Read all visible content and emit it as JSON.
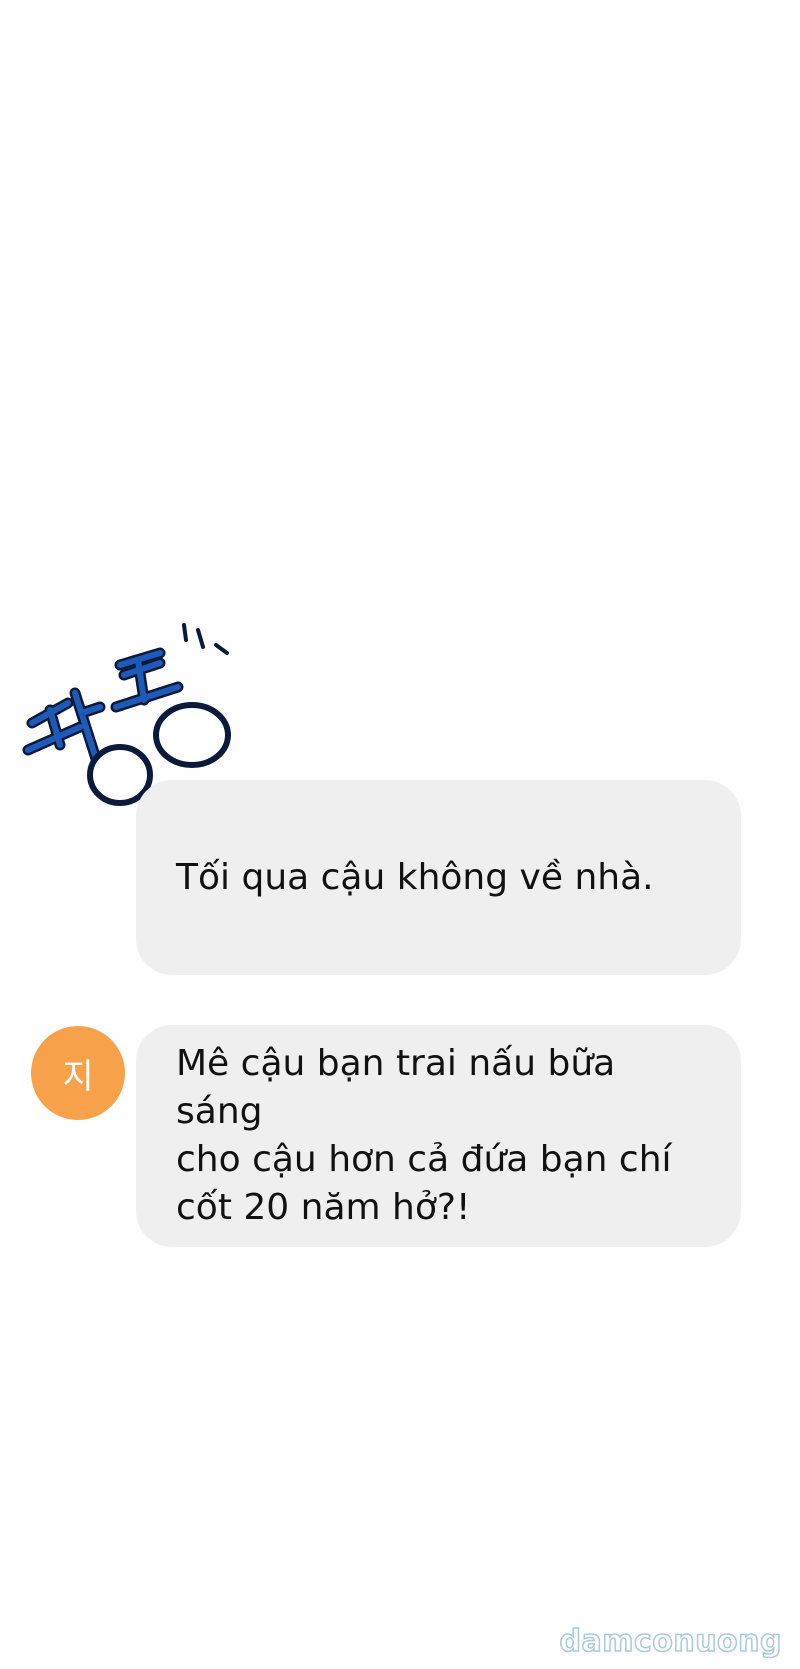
{
  "sfx": {
    "text": "띵동",
    "colors": {
      "fill": "#1e5bb8",
      "outline": "#0b1a3a"
    }
  },
  "messages": [
    {
      "text": "Tối qua cậu không về nhà."
    },
    {
      "text": "Mê cậu bạn trai nấu bữa sáng\ncho cậu hơn cả đứa bạn chí\ncốt 20 năm hở?!"
    }
  ],
  "avatar": {
    "label": "지",
    "color": "#f7a24a"
  },
  "bubble_color": "#efefef",
  "watermark": "damconuong"
}
